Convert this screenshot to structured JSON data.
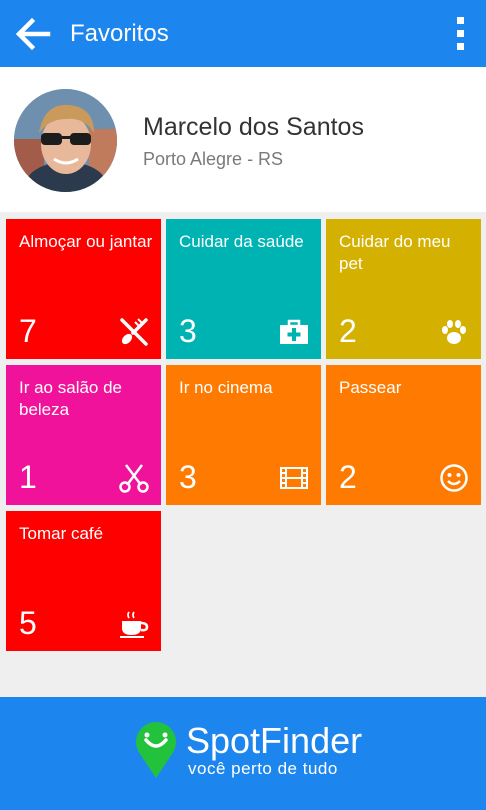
{
  "appbar": {
    "title": "Favoritos",
    "back_icon": "arrow-left-icon",
    "menu_icon": "more-vertical-icon"
  },
  "profile": {
    "name": "Marcelo dos Santos",
    "location": "Porto Alegre - RS"
  },
  "categories": [
    {
      "label": "Almoçar ou jantar",
      "count": "7",
      "icon": "fork-knife-icon",
      "color": "#ff0000"
    },
    {
      "label": "Cuidar da saúde",
      "count": "3",
      "icon": "medical-kit-icon",
      "color": "#00b3b3"
    },
    {
      "label": "Cuidar do meu pet",
      "count": "2",
      "icon": "paw-icon",
      "color": "#d4b100"
    },
    {
      "label": "Ir ao salão de beleza",
      "count": "1",
      "icon": "scissors-icon",
      "color": "#f0129a"
    },
    {
      "label": "Ir no cinema",
      "count": "3",
      "icon": "film-icon",
      "color": "#ff7a00"
    },
    {
      "label": "Passear",
      "count": "2",
      "icon": "smiley-icon",
      "color": "#ff7a00"
    },
    {
      "label": "Tomar café",
      "count": "5",
      "icon": "coffee-cup-icon",
      "color": "#ff0000"
    }
  ],
  "footer": {
    "brand": "SpotFinder",
    "tagline": "você perto de tudo",
    "logo_icon": "map-pin-smile-icon"
  },
  "colors": {
    "primary": "#1c86ee",
    "background": "#efefef",
    "logo_pin": "#23c23c"
  }
}
